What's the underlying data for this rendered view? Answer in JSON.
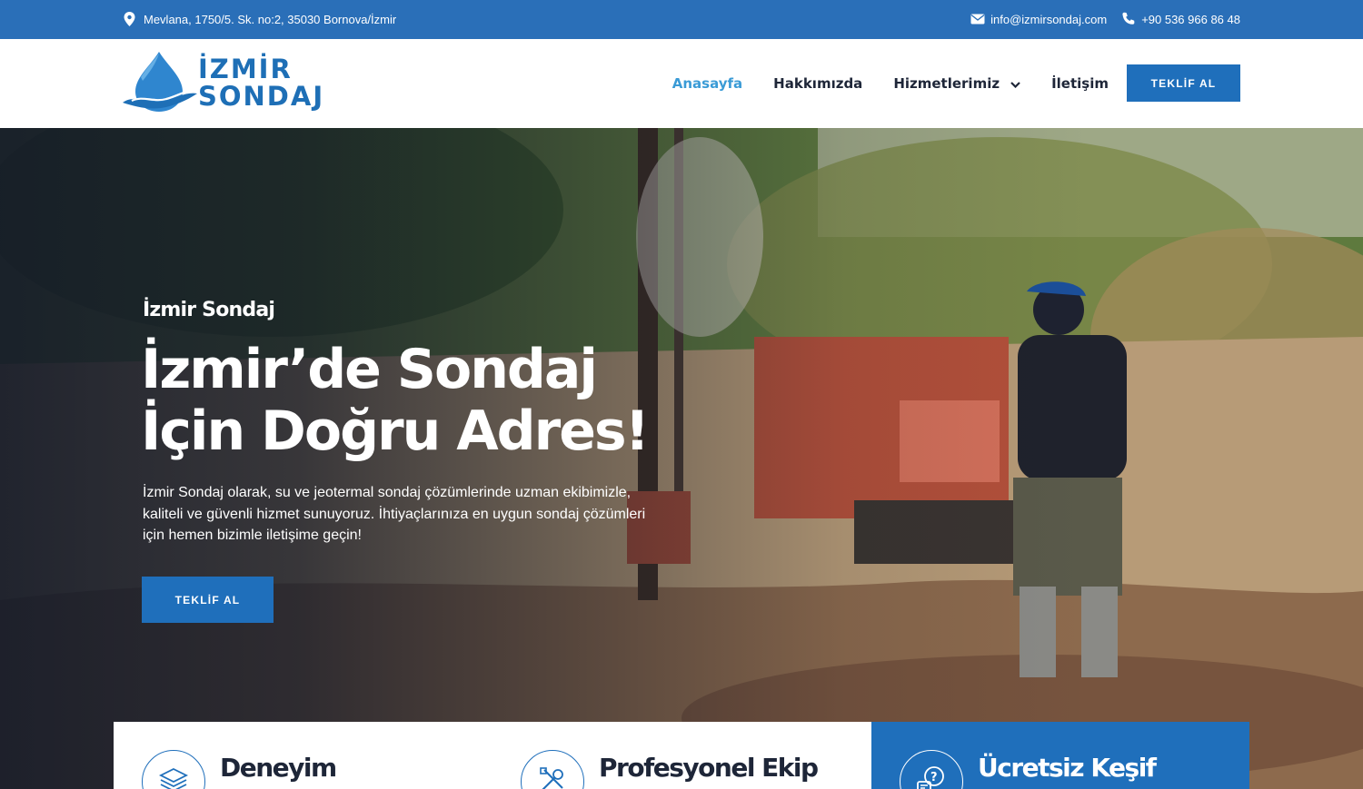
{
  "topbar": {
    "address": "Mevlana, 1750/5. Sk. no:2, 35030 Bornova/İzmir",
    "email": "info@izmirsondaj.com",
    "phone": "+90 536 966 86 48",
    "background": "#2a6fb8"
  },
  "header": {
    "logo": {
      "line1": "İZMİR",
      "line2": "SONDAJ"
    },
    "nav": [
      {
        "label": "Anasayfa",
        "active": true
      },
      {
        "label": "Hakkımızda"
      },
      {
        "label": "Hizmetlerimiz",
        "dropdown": true
      },
      {
        "label": "İletişim"
      }
    ],
    "cta_label": "TEKLİF AL"
  },
  "hero": {
    "kicker": "İzmir Sondaj",
    "title_line1": "İzmir’de Sondaj",
    "title_line2": "İçin Doğru Adres!",
    "description": "İzmir Sondaj olarak, su ve jeotermal sondaj çözümlerinde uzman ekibimizle, kaliteli ve güvenli hizmet sunuyoruz. İhtiyaçlarınıza en uygun sondaj çözümleri için hemen bizimle iletişime geçin!",
    "cta_label": "TEKLİF AL"
  },
  "features": [
    {
      "title": "Deneyim",
      "icon": "layers-icon"
    },
    {
      "title": "Profesyonel Ekip",
      "icon": "tools-icon"
    },
    {
      "title": "Ücretsiz Keşif",
      "icon": "question-chat-icon"
    }
  ],
  "colors": {
    "accent": "#1f6fbb",
    "active_nav": "#3a9bd6",
    "text_dark": "#1e2638"
  }
}
